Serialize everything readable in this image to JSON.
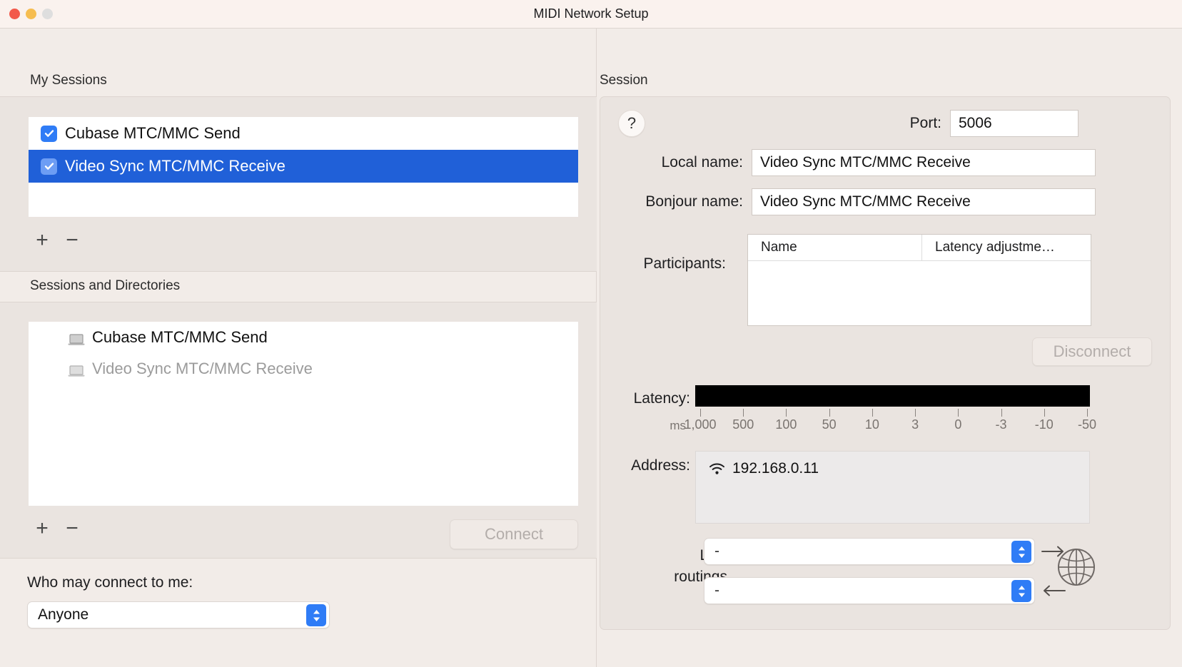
{
  "window": {
    "title": "MIDI Network Setup",
    "traffic_lights": [
      "close",
      "minimize",
      "zoom"
    ]
  },
  "my_sessions": {
    "header": "My Sessions",
    "rows": [
      {
        "label": "Cubase MTC/MMC Send",
        "checked": true,
        "selected": false
      },
      {
        "label": "Video Sync MTC/MMC Receive",
        "checked": true,
        "selected": true
      }
    ],
    "add_label": "+",
    "remove_label": "−"
  },
  "directories": {
    "header": "Sessions and Directories",
    "rows": [
      {
        "label": "Cubase MTC/MMC Send",
        "dimmed": false
      },
      {
        "label": "Video Sync MTC/MMC Receive",
        "dimmed": true
      }
    ],
    "add_label": "+",
    "remove_label": "−",
    "connect_label": "Connect"
  },
  "who_may_connect": {
    "label": "Who may connect to me:",
    "value": "Anyone"
  },
  "session": {
    "header": "Session",
    "help_label": "?",
    "port_label": "Port:",
    "port_value": "5006",
    "local_name_label": "Local name:",
    "local_name_value": "Video Sync MTC/MMC Receive",
    "bonjour_name_label": "Bonjour name:",
    "bonjour_name_value": "Video Sync MTC/MMC Receive",
    "participants_label": "Participants:",
    "participants_columns": [
      "Name",
      "Latency adjustme…"
    ],
    "participants_rows": [],
    "disconnect_label": "Disconnect",
    "latency_label": "Latency:",
    "latency_unit": "ms",
    "latency_ticks": [
      "1,000",
      "500",
      "100",
      "50",
      "10",
      "3",
      "0",
      "-3",
      "-10",
      "-50"
    ],
    "address_label": "Address:",
    "address_value": "192.168.0.11",
    "address_icon": "wifi-icon",
    "live_routings_label_line1": "Live",
    "live_routings_label_line2": "routings",
    "live_routing_out_value": "-",
    "live_routing_in_value": "-",
    "arrow_out": "→",
    "arrow_in": "←",
    "globe_icon": "globe-icon"
  },
  "colors": {
    "accent_blue": "#2f7cf6",
    "selection_blue": "#2060d8",
    "window_bg": "#f2ece8",
    "panel_bg": "#eae4e0",
    "titlebar_bg": "#faf2ee"
  }
}
